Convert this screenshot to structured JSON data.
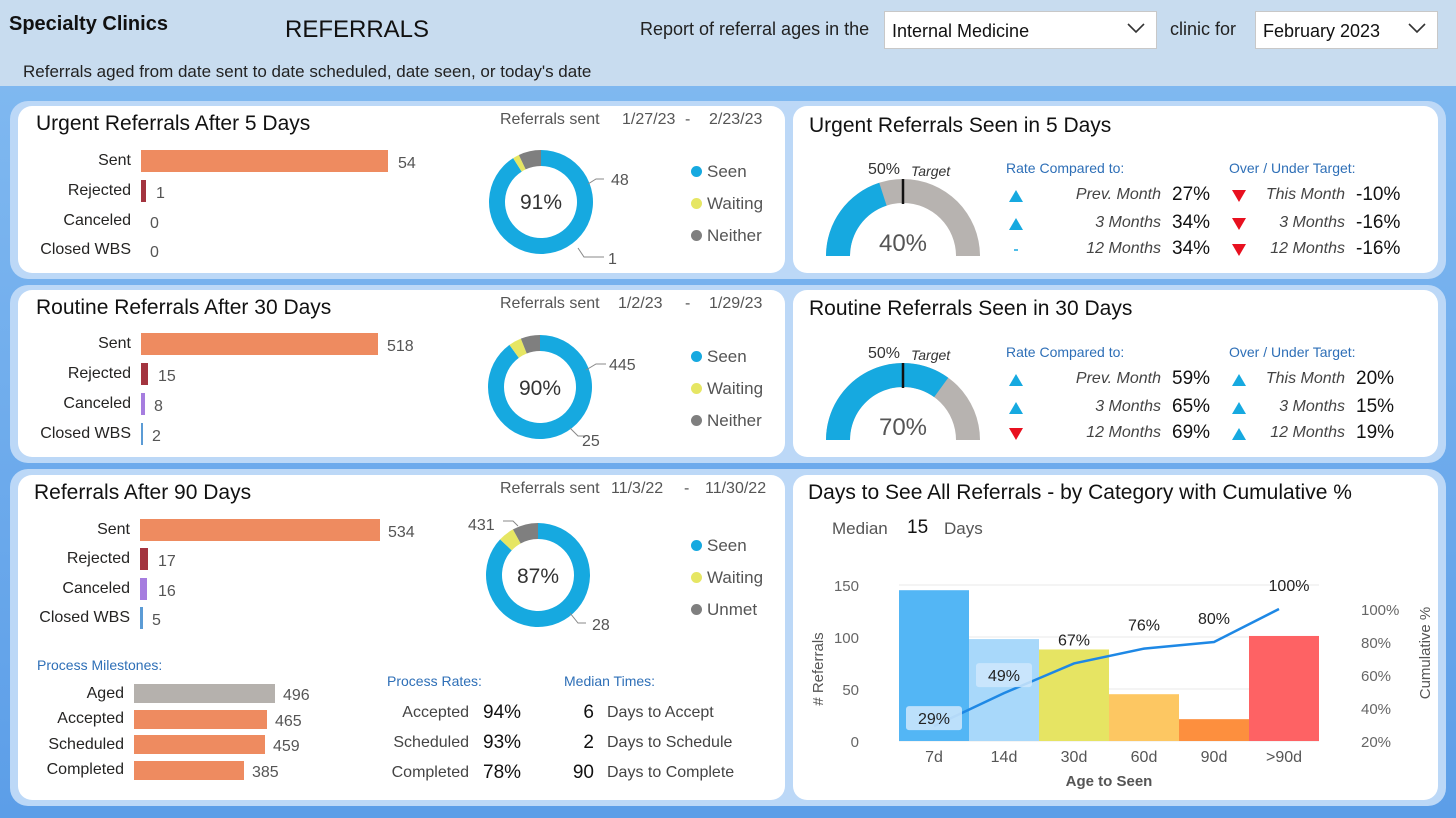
{
  "header": {
    "app_title": "Specialty Clinics",
    "page_title": "REFERRALS",
    "report_label": "Report of referral ages in the",
    "clinic_value": "Internal Medicine",
    "clinic_for": "clinic for",
    "month_value": "February 2023",
    "subtitle": "Referrals aged from date sent to date scheduled, date seen, or today's date"
  },
  "urgent": {
    "title": "Urgent Referrals After 5 Days",
    "sent_label": "Referrals sent",
    "from": "1/27/23",
    "dash": "-",
    "to": "2/23/23",
    "rows": [
      {
        "label": "Sent",
        "value": "54"
      },
      {
        "label": "Rejected",
        "value": "1"
      },
      {
        "label": "Canceled",
        "value": "0"
      },
      {
        "label": "Closed WBS",
        "value": "0"
      }
    ],
    "donut": {
      "pct": "91%",
      "seen": "48",
      "other": "1",
      "seen_frac": 0.91,
      "waiting_frac": 0.02,
      "neither_frac": 0.07
    },
    "legend": [
      "Seen",
      "Waiting",
      "Neither"
    ]
  },
  "urgent_seen": {
    "title": "Urgent Referrals Seen in 5 Days",
    "target_pct": "50%",
    "target_word": "Target",
    "gauge_value": "40%",
    "gauge_frac": 0.4,
    "rate_header": "Rate Compared to:",
    "over_header": "Over / Under Target:",
    "rates": [
      {
        "label": "Prev. Month",
        "value": "27%",
        "icon": "up"
      },
      {
        "label": "3 Months",
        "value": "34%",
        "icon": "up"
      },
      {
        "label": "12 Months",
        "value": "34%",
        "icon": "dash"
      }
    ],
    "over": [
      {
        "label": "This Month",
        "value": "-10%",
        "icon": "down"
      },
      {
        "label": "3 Months",
        "value": "-16%",
        "icon": "down"
      },
      {
        "label": "12 Months",
        "value": "-16%",
        "icon": "down"
      }
    ]
  },
  "routine": {
    "title": "Routine Referrals After 30 Days",
    "sent_label": "Referrals sent",
    "from": "1/2/23",
    "dash": "-",
    "to": "1/29/23",
    "rows": [
      {
        "label": "Sent",
        "value": "518"
      },
      {
        "label": "Rejected",
        "value": "15"
      },
      {
        "label": "Canceled",
        "value": "8"
      },
      {
        "label": "Closed WBS",
        "value": "2"
      }
    ],
    "donut": {
      "pct": "90%",
      "seen": "445",
      "other": "25",
      "seen_frac": 0.9,
      "waiting_frac": 0.04,
      "neither_frac": 0.06
    },
    "legend": [
      "Seen",
      "Waiting",
      "Neither"
    ]
  },
  "routine_seen": {
    "title": "Routine Referrals Seen in 30 Days",
    "target_pct": "50%",
    "target_word": "Target",
    "gauge_value": "70%",
    "gauge_frac": 0.7,
    "rate_header": "Rate Compared to:",
    "over_header": "Over / Under Target:",
    "rates": [
      {
        "label": "Prev. Month",
        "value": "59%",
        "icon": "up"
      },
      {
        "label": "3 Months",
        "value": "65%",
        "icon": "up"
      },
      {
        "label": "12 Months",
        "value": "69%",
        "icon": "down"
      }
    ],
    "over": [
      {
        "label": "This Month",
        "value": "20%",
        "icon": "up"
      },
      {
        "label": "3 Months",
        "value": "15%",
        "icon": "up"
      },
      {
        "label": "12 Months",
        "value": "19%",
        "icon": "up"
      }
    ]
  },
  "ninety": {
    "title": "Referrals After 90 Days",
    "sent_label": "Referrals sent",
    "from": "11/3/22",
    "dash": "-",
    "to": "11/30/22",
    "rows": [
      {
        "label": "Sent",
        "value": "534"
      },
      {
        "label": "Rejected",
        "value": "17"
      },
      {
        "label": "Canceled",
        "value": "16"
      },
      {
        "label": "Closed WBS",
        "value": "5"
      }
    ],
    "donut": {
      "pct": "87%",
      "seen": "431",
      "other": "28",
      "seen_frac": 0.87,
      "waiting_frac": 0.05,
      "neither_frac": 0.08
    },
    "legend": [
      "Seen",
      "Waiting",
      "Unmet"
    ],
    "milestones_header": "Process Milestones:",
    "milestones": [
      {
        "label": "Aged",
        "value": "496"
      },
      {
        "label": "Accepted",
        "value": "465"
      },
      {
        "label": "Scheduled",
        "value": "459"
      },
      {
        "label": "Completed",
        "value": "385"
      }
    ],
    "rates_header": "Process Rates:",
    "rates": [
      {
        "label": "Accepted",
        "value": "94%"
      },
      {
        "label": "Scheduled",
        "value": "93%"
      },
      {
        "label": "Completed",
        "value": "78%"
      }
    ],
    "median_header": "Median Times:",
    "medians": [
      {
        "value": "6",
        "label": "Days to Accept"
      },
      {
        "value": "2",
        "label": "Days to Schedule"
      },
      {
        "value": "90",
        "label": "Days to Complete"
      }
    ]
  },
  "days_chart": {
    "title": "Days to See All Referrals - by Category with Cumulative %",
    "median_label": "Median",
    "median_value": "15",
    "median_unit": "Days"
  },
  "colors": {
    "bar_orange": "#ee8b60",
    "rejected": "#a3343f",
    "canceled": "#a67ddf",
    "closed": "#5b9bd5",
    "seen": "#16a9e0",
    "waiting": "#e6e663",
    "neither": "#7f7f7f",
    "gauge_bg": "#b7b3b0",
    "milestone_grey": "#b5b1ad"
  },
  "chart_data": {
    "type": "bar",
    "categories": [
      "7d",
      "14d",
      "30d",
      "60d",
      "90d",
      ">90d"
    ],
    "values": [
      145,
      98,
      88,
      45,
      21,
      101
    ],
    "cumulative": [
      29,
      49,
      67,
      76,
      80,
      100
    ],
    "cumulative_labels": [
      "29%",
      "49%",
      "67%",
      "76%",
      "80%",
      "100%"
    ],
    "bar_colors": [
      "#53b6f5",
      "#a8d8fa",
      "#e6e463",
      "#fdc762",
      "#fd8f3e",
      "#fe6264"
    ],
    "xlabel": "Age to Seen",
    "ylabel": "# Referrals",
    "y2label": "Cumulative %",
    "ylim": [
      0,
      150
    ],
    "yticks": [
      "0",
      "50",
      "100",
      "150"
    ],
    "y2lim": [
      20,
      100
    ],
    "y2ticks": [
      "20%",
      "40%",
      "60%",
      "80%",
      "100%"
    ]
  }
}
